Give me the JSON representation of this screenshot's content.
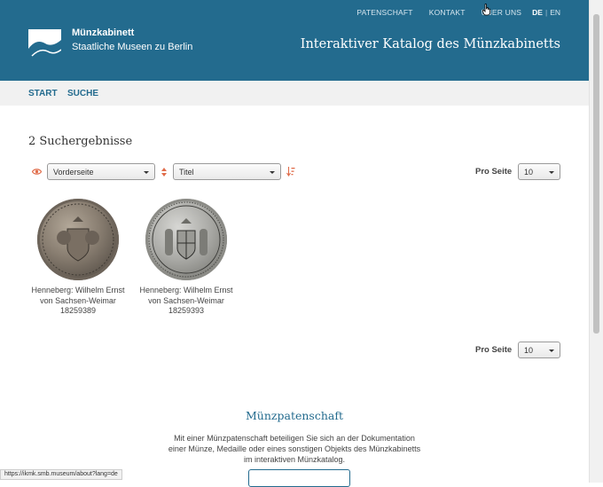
{
  "header": {
    "brand_name": "Münzkabinett",
    "brand_sub": "Staatliche Museen zu Berlin",
    "catalog_title": "Interaktiver Katalog des Münzkabinetts",
    "top_links": [
      "PATENSCHAFT",
      "KONTAKT",
      "ÜBER UNS"
    ],
    "lang_active": "DE",
    "lang_sep": "|",
    "lang_other": "EN"
  },
  "nav": {
    "start": "START",
    "search": "SUCHE"
  },
  "results": {
    "title": "2 Suchergebnisse",
    "view_select": "Vorderseite",
    "sort_select": "Titel",
    "per_page_label": "Pro Seite",
    "per_page_value": "10",
    "items": [
      {
        "title_line1": "Henneberg: Wilhelm Ernst",
        "title_line2": "von Sachsen-Weimar",
        "id": "18259389"
      },
      {
        "title_line1": "Henneberg: Wilhelm Ernst",
        "title_line2": "von Sachsen-Weimar",
        "id": "18259393"
      }
    ]
  },
  "bottom_pager": {
    "per_page_label": "Pro Seite",
    "per_page_value": "10"
  },
  "patenschaft": {
    "title": "Münzpatenschaft",
    "text_line1": "Mit einer Münzpatenschaft beteiligen Sie sich an der Dokumentation",
    "text_line2": "einer Münze, Medaille oder eines sonstigen Objekts des Münzkabinetts",
    "text_line3": "im interaktiven Münzkatalog."
  },
  "status_bar": {
    "url": "https://ikmk.smb.museum/about?lang=de"
  },
  "colors": {
    "brand": "#236b8e",
    "nav_bg": "#f1f1f1",
    "accent_icon": "#e06c4a"
  }
}
